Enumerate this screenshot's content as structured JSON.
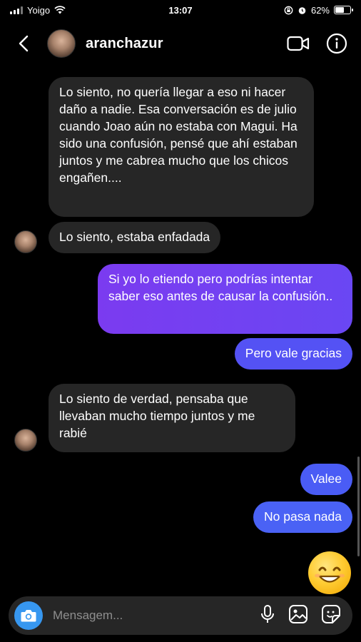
{
  "status_bar": {
    "carrier": "Yoigo",
    "time": "13:07",
    "battery": "62%",
    "battery_level": 0.62
  },
  "header": {
    "username": "aranchazur"
  },
  "messages": [
    {
      "direction": "incoming",
      "text": "Lo siento, no quería llegar a eso ni hacer daño a nadie. Esa conversación es de julio cuando Joao aún no estaba con Magui. Ha sido una confusión, pensé que ahí estaban juntos y me cabrea mucho que los chicos engañen...."
    },
    {
      "direction": "incoming",
      "text": "Lo siento, estaba enfadada"
    },
    {
      "direction": "outgoing",
      "text": "Si yo lo etiendo pero podrías intentar saber eso antes de causar la confusión.."
    },
    {
      "direction": "outgoing",
      "text": "Pero vale gracias"
    },
    {
      "direction": "incoming",
      "text": "Lo siento de verdad, pensaba que llevaban mucho tiempo juntos y me rabié"
    },
    {
      "direction": "outgoing",
      "text": "Valee"
    },
    {
      "direction": "outgoing",
      "text": "No pasa nada"
    }
  ],
  "emoji": "smiling-face",
  "composer": {
    "placeholder": "Mensagem..."
  },
  "colors": {
    "background": "#000000",
    "incoming_bubble": "#262626",
    "outgoing_purple": "#7a3df0",
    "outgoing_blue": "#4b5ef5",
    "camera_button": "#3797f0"
  }
}
